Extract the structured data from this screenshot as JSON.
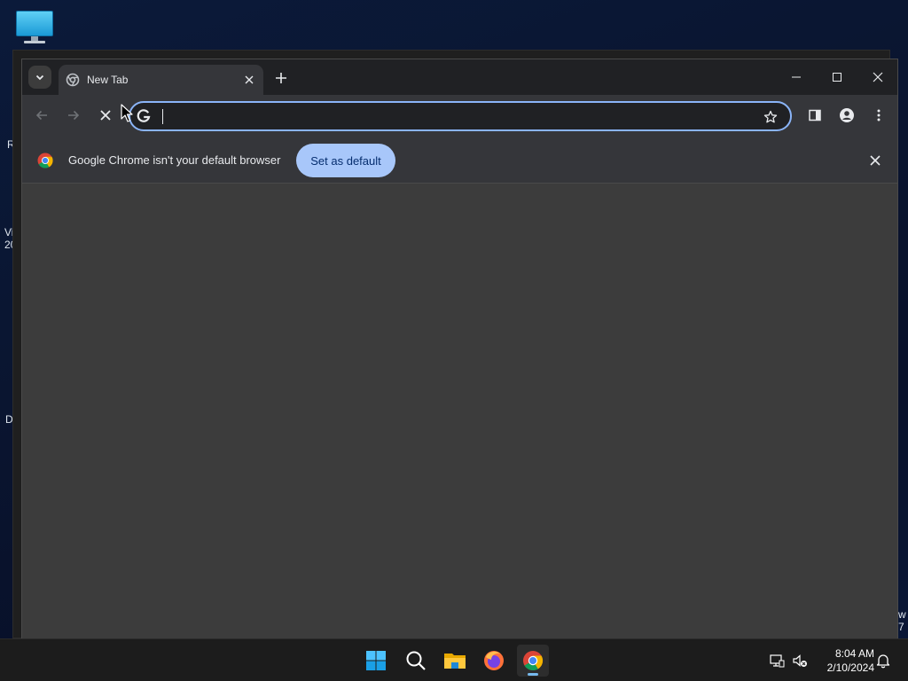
{
  "desktop": {
    "edge_texts": [
      "R",
      "Vi",
      "20",
      "D",
      "w",
      "7"
    ]
  },
  "browser": {
    "tab": {
      "title": "New Tab"
    },
    "omnibox": {
      "value": "",
      "placeholder": ""
    },
    "infobar": {
      "message": "Google Chrome isn't your default browser",
      "button_label": "Set as default"
    }
  },
  "taskbar": {
    "icons": [
      "start-icon",
      "search-icon",
      "file-explorer-icon",
      "firefox-icon",
      "chrome-icon"
    ],
    "clock": {
      "time": "8:04 AM",
      "date": "2/10/2024"
    }
  },
  "colors": {
    "accent": "#8ab4f8",
    "infobar_button": "#a8c7fa",
    "taskbar_indicator": "#76b9ed"
  }
}
